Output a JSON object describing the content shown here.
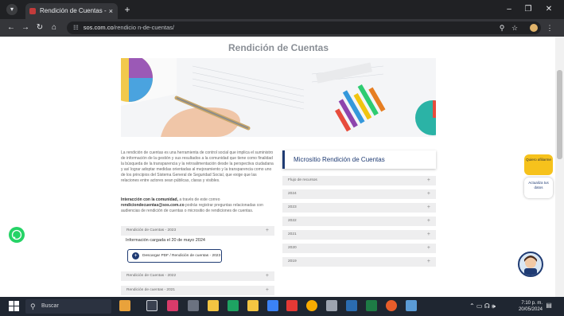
{
  "browser": {
    "tab_title": "Rendición de Cuentas - S.O.S",
    "tab_close": "×",
    "new_tab": "+",
    "url_domain": "sos.com.co",
    "url_path": "/rendicio n-de-cuentas/",
    "minimize": "–",
    "maximize": "❐",
    "close": "✕"
  },
  "page": {
    "title": "Rendición de Cuentas",
    "intro": "La rendición de cuentas es una herramienta de control social que implica el suministro de información de la gestión y sus resultados a la comunidad que tiene como finalidad la búsqueda de la transparencia y la retroalimentación desde la perspectiva ciudadana y así lograr adoptar medidas orientadas al mejoramiento y la transparencia como uno de los principios del Sistema General de Seguridad Social, que exige que las relaciones entre actores sean públicas, claras y visibles.",
    "interaction_bold": "Interacción con la comunidad,",
    "interaction_text": " a través de este correo",
    "interaction_email": "rendiciondecuentas@sos.com.co",
    "interaction_rest": " podrás registrar preguntas relacionadas con audiencias de rendición de cuentas o micrositio de rendiciones de cuentas.",
    "left_accordions": [
      {
        "label": "Rendición de Cuentas - 2023",
        "icon": "+"
      },
      {
        "label": "Rendición de Cuentas - 2022",
        "icon": "+"
      },
      {
        "label": "Rendición de cuentas - 2021",
        "icon": "+"
      }
    ],
    "info_cargada": "Información cargada el 20 de mayo 2024",
    "download_label": "Descargar PDF / Rendición de cuentas - 2023",
    "download_icon": "+",
    "microsite_title": "Micrositio Rendición de Cuentas",
    "right_accordions": [
      {
        "label": "Flujo de recursos",
        "icon": "+"
      },
      {
        "label": "2024",
        "icon": "+"
      },
      {
        "label": "2023",
        "icon": "+"
      },
      {
        "label": "2022",
        "icon": "+"
      },
      {
        "label": "2021",
        "icon": "+"
      },
      {
        "label": "2020",
        "icon": "+"
      },
      {
        "label": "2019",
        "icon": "+"
      }
    ],
    "side_quiero": "Quiero afiliarme",
    "side_actualiza": "Actualiza tus datos"
  },
  "taskbar": {
    "search_placeholder": "Buscar",
    "time": "7:10 p. m.",
    "date": "20/05/2024"
  },
  "colors": {
    "brand_blue": "#1f3b73",
    "accent_yellow": "#f6c21c",
    "whatsapp": "#25d366"
  }
}
